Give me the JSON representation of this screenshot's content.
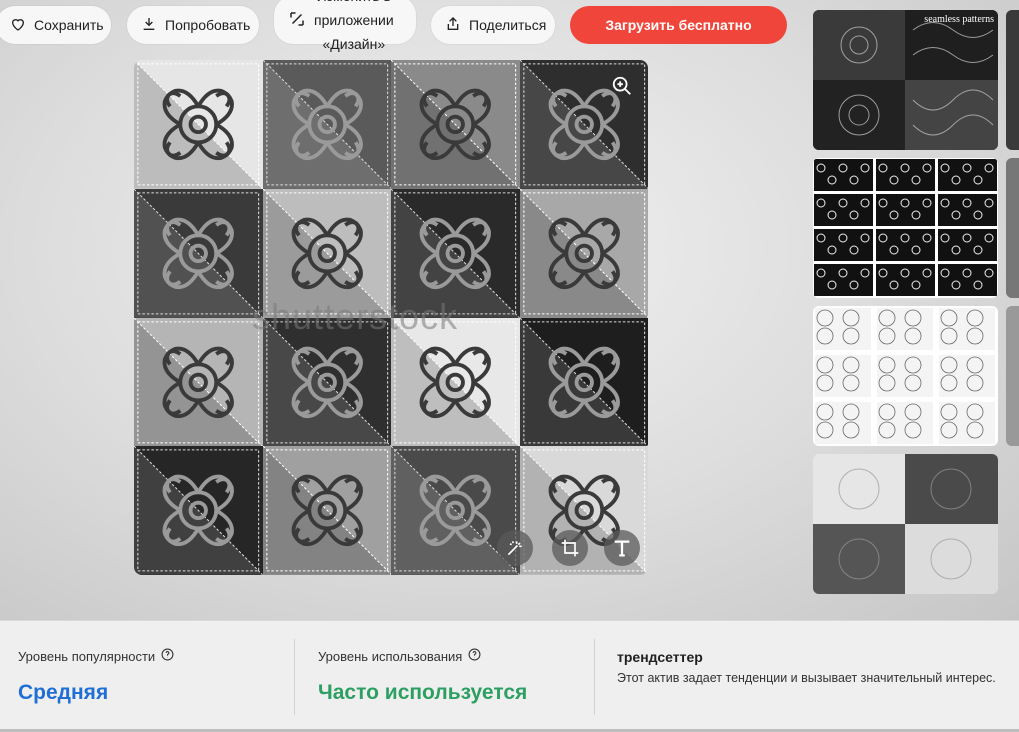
{
  "toolbar": {
    "save_label": "Сохранить",
    "try_label": "Попробовать",
    "edit_line1": "Изменить в",
    "edit_line2": "приложении",
    "edit_line3": "«Дизайн»",
    "share_label": "Поделиться",
    "download_label": "Загрузить бесплатно"
  },
  "image": {
    "watermark": "shutterstock",
    "tile_shades": [
      "#e6e6e6",
      "#5a5a5a",
      "#8a8a8a",
      "#2e2e2e",
      "#3a3a3a",
      "#bdbdbd",
      "#2a2a2a",
      "#a8a8a8",
      "#b5b5b5",
      "#2f2f2f",
      "#e8e8e8",
      "#1e1e1e",
      "#262626",
      "#a0a0a0",
      "#4a4a4a",
      "#d9d9d9"
    ],
    "tools": [
      "magic-wand-icon",
      "crop-icon",
      "text-icon"
    ]
  },
  "thumbnails": {
    "first_label": "seamless patterns"
  },
  "stats": {
    "popularity_caption": "Уровень популярности",
    "popularity_value": "Средняя",
    "usage_caption": "Уровень использования",
    "usage_value": "Часто используется",
    "trend_title": "трендсеттер",
    "trend_desc": "Этот актив задает тенденции и вызывает значительный интерес."
  },
  "colors": {
    "accent": "#f0453a",
    "popularity": "#1f6fd6",
    "usage": "#2e9f63"
  }
}
